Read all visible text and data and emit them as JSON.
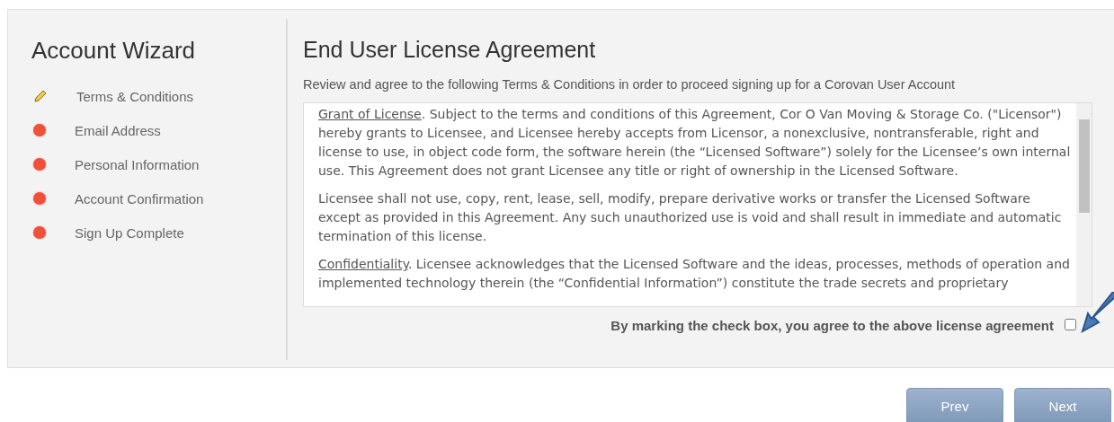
{
  "sidebar": {
    "title": "Account Wizard",
    "steps": [
      {
        "label": "Terms & Conditions",
        "kind": "current"
      },
      {
        "label": "Email Address",
        "kind": "pending"
      },
      {
        "label": "Personal Information",
        "kind": "pending"
      },
      {
        "label": "Account Confirmation",
        "kind": "pending"
      },
      {
        "label": "Sign Up Complete",
        "kind": "pending"
      }
    ]
  },
  "main": {
    "title": "End User License Agreement",
    "intro": "Review and agree to the following Terms & Conditions in order to proceed signing up for a Corovan User Account",
    "paragraphs": [
      {
        "heading": "Grant of License",
        "text": ". Subject to the terms and conditions of this Agreement, Cor O Van Moving & Storage Co. (\"Licensor\") hereby grants to Licensee, and Licensee hereby accepts from Licensor, a nonexclusive, nontransferable, right and license to use, in object code form, the software herein (the “Licensed Software”) solely for the Licensee’s own internal use. This Agreement does not grant Licensee any title or right of ownership in the Licensed Software."
      },
      {
        "text": "Licensee shall not use, copy, rent, lease, sell, modify, prepare derivative works or transfer the Licensed Software except as provided in this Agreement. Any such unauthorized use is void and shall result in immediate and automatic termination of this license."
      },
      {
        "heading": "Confidentiality",
        "text": ". Licensee acknowledges that the Licensed Software and the ideas, processes, methods of operation and implemented technology therein (the “Confidential Information”) constitute the trade secrets and proprietary"
      }
    ],
    "agree": {
      "label": "By marking the check box, you agree to the above license agreement",
      "checked": false
    }
  },
  "buttons": [
    {
      "label": "Prev"
    },
    {
      "label": "Next"
    }
  ]
}
